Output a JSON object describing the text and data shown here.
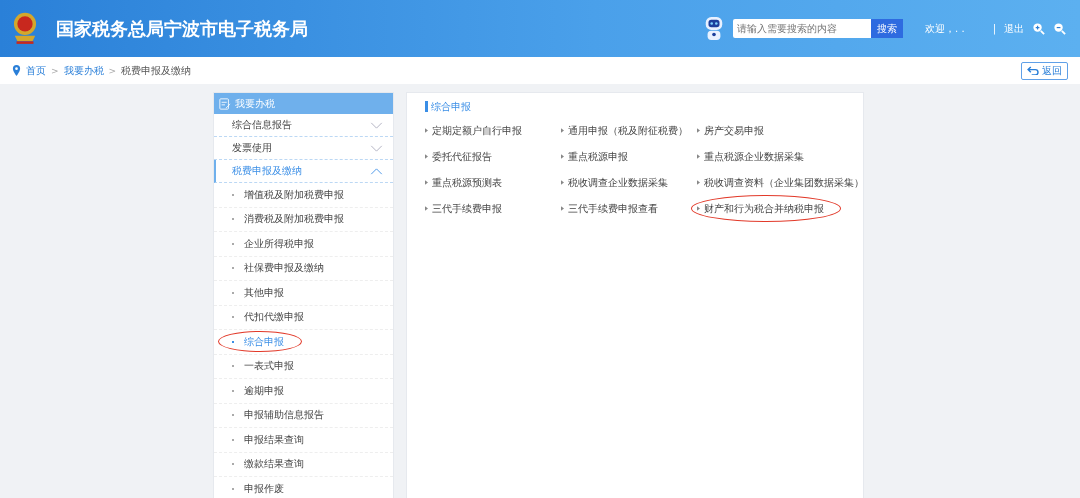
{
  "header": {
    "title": "国家税务总局宁波市电子税务局",
    "search": {
      "placeholder": "请输入需要搜索的内容",
      "button": "搜索"
    },
    "welcome": "欢迎，. .",
    "separator": "|",
    "logout": "退出"
  },
  "breadcrumb": {
    "items": [
      "首页",
      "我要办税",
      "税费申报及缴纳"
    ],
    "separator": ">",
    "back": "返回"
  },
  "sidebar": {
    "title": "我要办税",
    "sections": [
      {
        "label": "综合信息报告",
        "expanded": false
      },
      {
        "label": "发票使用",
        "expanded": false
      },
      {
        "label": "税费申报及缴纳",
        "expanded": true,
        "children": [
          {
            "label": "增值税及附加税费申报",
            "selected": false,
            "circled": false
          },
          {
            "label": "消费税及附加税费申报",
            "selected": false,
            "circled": false
          },
          {
            "label": "企业所得税申报",
            "selected": false,
            "circled": false
          },
          {
            "label": "社保费申报及缴纳",
            "selected": false,
            "circled": false
          },
          {
            "label": "其他申报",
            "selected": false,
            "circled": false
          },
          {
            "label": "代扣代缴申报",
            "selected": false,
            "circled": false
          },
          {
            "label": "综合申报",
            "selected": true,
            "circled": true
          },
          {
            "label": "一表式申报",
            "selected": false,
            "circled": false
          },
          {
            "label": "逾期申报",
            "selected": false,
            "circled": false
          },
          {
            "label": "申报辅助信息报告",
            "selected": false,
            "circled": false
          },
          {
            "label": "申报结果查询",
            "selected": false,
            "circled": false
          },
          {
            "label": "缴款结果查询",
            "selected": false,
            "circled": false
          },
          {
            "label": "申报作废",
            "selected": false,
            "circled": false
          }
        ]
      }
    ]
  },
  "panel": {
    "title": "综合申报",
    "links": [
      {
        "label": "定期定额户自行申报",
        "circled": false
      },
      {
        "label": "通用申报（税及附征税费）",
        "circled": false
      },
      {
        "label": "房产交易申报",
        "circled": false
      },
      {
        "label": "委托代征报告",
        "circled": false
      },
      {
        "label": "重点税源申报",
        "circled": false
      },
      {
        "label": "重点税源企业数据采集",
        "circled": false
      },
      {
        "label": "重点税源预测表",
        "circled": false
      },
      {
        "label": "税收调查企业数据采集",
        "circled": false
      },
      {
        "label": "税收调查资料（企业集团数据采集）",
        "circled": false
      },
      {
        "label": "三代手续费申报",
        "circled": false
      },
      {
        "label": "三代手续费申报查看",
        "circled": false
      },
      {
        "label": "财产和行为税合并纳税申报",
        "circled": true
      }
    ]
  }
}
